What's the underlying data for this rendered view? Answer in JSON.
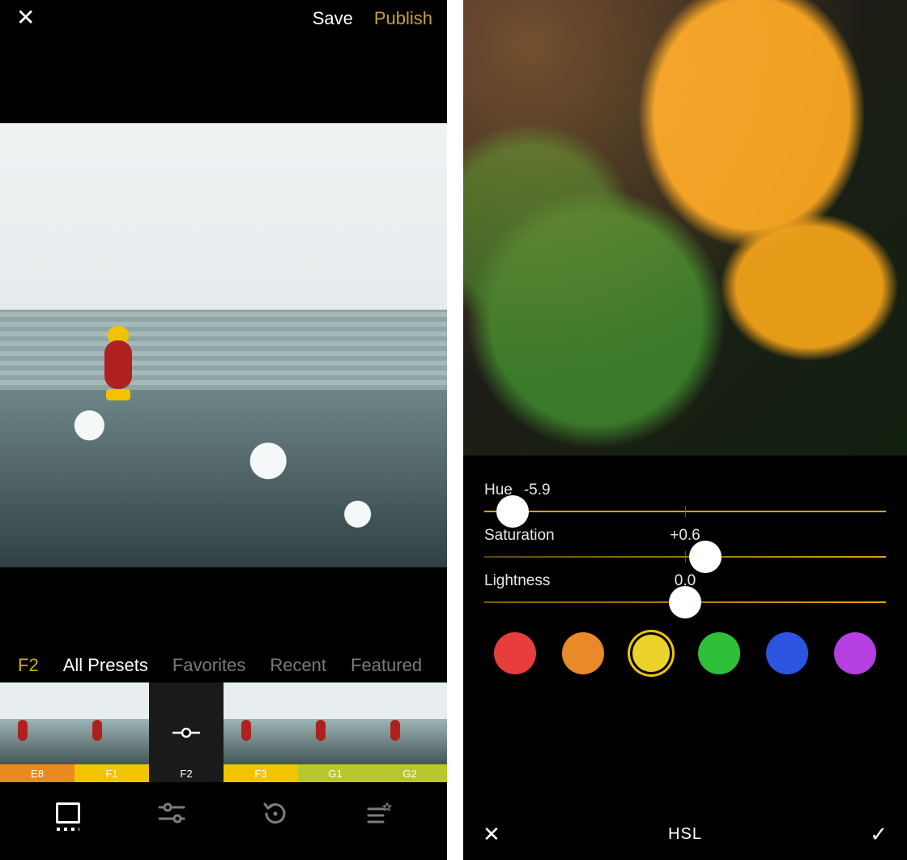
{
  "left": {
    "header": {
      "save": "Save",
      "publish": "Publish"
    },
    "tabs": {
      "current_preset": "F2",
      "all_presets": "All Presets",
      "favorites": "Favorites",
      "recent": "Recent",
      "featured": "Featured"
    },
    "presets": [
      {
        "code": "E8",
        "barColor": "#e88a1e",
        "selected": false
      },
      {
        "code": "F1",
        "barColor": "#f0c400",
        "selected": false
      },
      {
        "code": "F2",
        "barColor": "#1a1a1a",
        "selected": true
      },
      {
        "code": "F3",
        "barColor": "#f0c400",
        "selected": false
      },
      {
        "code": "G1",
        "barColor": "#b8c72e",
        "selected": false
      },
      {
        "code": "G2",
        "barColor": "#b8c72e",
        "selected": false
      }
    ],
    "toolbar": {
      "active": "presets",
      "items": [
        "presets",
        "adjust",
        "history",
        "recipes"
      ]
    }
  },
  "right": {
    "panel_title": "HSL",
    "sliders": {
      "hue": {
        "label": "Hue",
        "value": "-5.9",
        "position": 0.07
      },
      "saturation": {
        "label": "Saturation",
        "value": "+0.6",
        "position": 0.55
      },
      "lightness": {
        "label": "Lightness",
        "value": "0.0",
        "position": 0.5
      }
    },
    "swatches": [
      {
        "name": "red",
        "hex": "#e73d3d",
        "selected": false
      },
      {
        "name": "orange",
        "hex": "#e88a2a",
        "selected": false
      },
      {
        "name": "yellow",
        "hex": "#ecd22b",
        "selected": true
      },
      {
        "name": "green",
        "hex": "#2fbf3b",
        "selected": false
      },
      {
        "name": "blue",
        "hex": "#2b55e0",
        "selected": false
      },
      {
        "name": "purple",
        "hex": "#b53fe0",
        "selected": false
      }
    ]
  }
}
